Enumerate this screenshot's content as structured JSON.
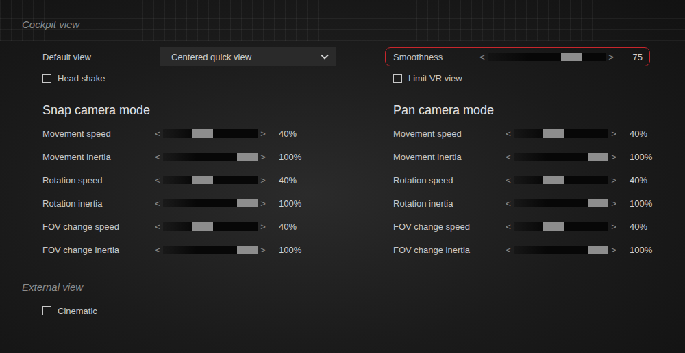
{
  "cockpit": {
    "title": "Cockpit view",
    "columns": [
      {
        "top": {
          "kind": "dropdown",
          "label": "Default view",
          "value": "Centered quick view",
          "expanded": false
        },
        "checkbox": {
          "label": "Head shake",
          "checked": false
        },
        "mode": {
          "title": "Snap camera mode",
          "sliders": [
            {
              "label": "Movement speed",
              "dec": "<",
              "inc": ">",
              "level": 0.4,
              "reading": "40%"
            },
            {
              "label": "Movement inertia",
              "dec": "<",
              "inc": ">",
              "level": 1.0,
              "reading": "100%"
            },
            {
              "label": "Rotation speed",
              "dec": "<",
              "inc": ">",
              "level": 0.4,
              "reading": "40%"
            },
            {
              "label": "Rotation inertia",
              "dec": "<",
              "inc": ">",
              "level": 1.0,
              "reading": "100%"
            },
            {
              "label": "FOV change speed",
              "dec": "<",
              "inc": ">",
              "level": 0.4,
              "reading": "40%"
            },
            {
              "label": "FOV change inertia",
              "dec": "<",
              "inc": ">",
              "level": 1.0,
              "reading": "100%"
            }
          ]
        }
      },
      {
        "top": {
          "kind": "slider",
          "label": "Smoothness",
          "dec": "<",
          "inc": ">",
          "level": 0.75,
          "reading": "75",
          "highlighted": true
        },
        "checkbox": {
          "label": "Limit VR view",
          "checked": false
        },
        "mode": {
          "title": "Pan camera mode",
          "sliders": [
            {
              "label": "Movement speed",
              "dec": "<",
              "inc": ">",
              "level": 0.4,
              "reading": "40%"
            },
            {
              "label": "Movement inertia",
              "dec": "<",
              "inc": ">",
              "level": 1.0,
              "reading": "100%"
            },
            {
              "label": "Rotation speed",
              "dec": "<",
              "inc": ">",
              "level": 0.4,
              "reading": "40%"
            },
            {
              "label": "Rotation inertia",
              "dec": "<",
              "inc": ">",
              "level": 1.0,
              "reading": "100%"
            },
            {
              "label": "FOV change speed",
              "dec": "<",
              "inc": ">",
              "level": 0.4,
              "reading": "40%"
            },
            {
              "label": "FOV change inertia",
              "dec": "<",
              "inc": ">",
              "level": 1.0,
              "reading": "100%"
            }
          ]
        }
      }
    ]
  },
  "external": {
    "title": "External view",
    "checkboxes": [
      {
        "label": "Cinematic",
        "checked": false
      }
    ]
  }
}
